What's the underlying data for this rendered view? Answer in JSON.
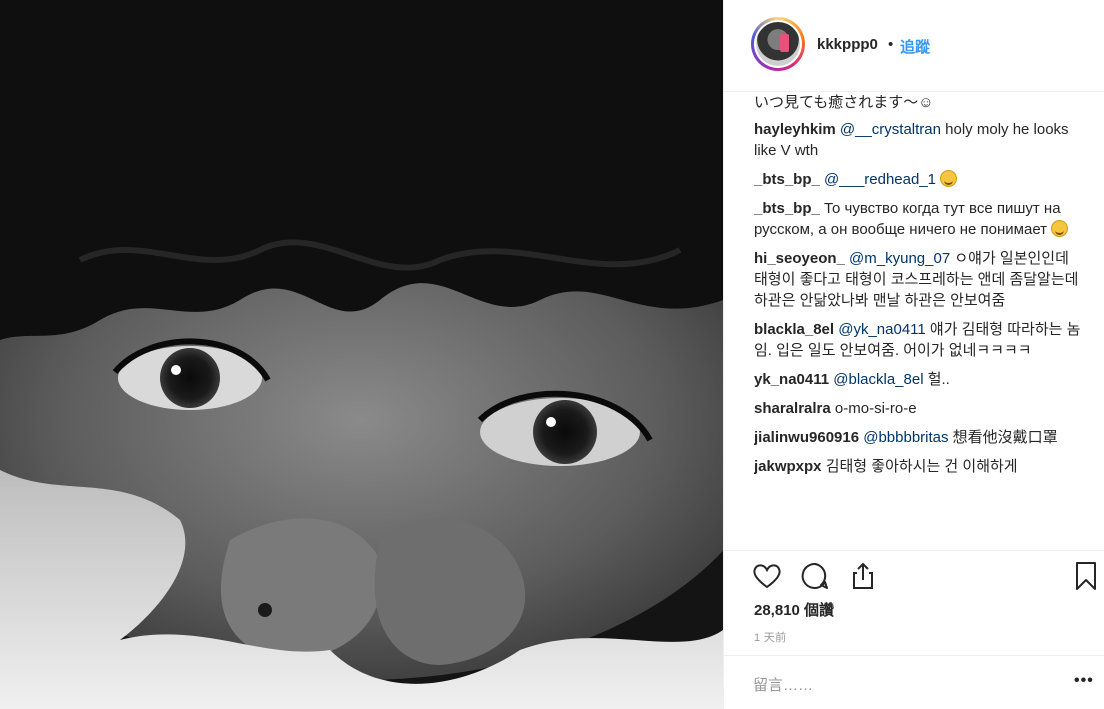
{
  "post": {
    "username": "kkkppp0",
    "separator": "•",
    "follow_label": "追蹤"
  },
  "comments": [
    {
      "text": "いつ見ても癒されます〜☺"
    },
    {
      "user": "hayleyhkim",
      "mention": "@__crystaltran",
      "text": " holy moly he looks like V wth"
    },
    {
      "user": "_bts_bp_",
      "mention": "@___redhead_1",
      "text": " ",
      "emoji": "grinning-sweat-emoji"
    },
    {
      "user": "_bts_bp_",
      "text": " То чувство когда тут все пишут на русском, а он вообще ничего не понимает ",
      "emoji": "grinning-sweat-emoji"
    },
    {
      "user": "hi_seoyeon_",
      "mention": "@m_kyung_07",
      "text": " ㅇ얘가 일본인인데 태형이 좋다고 태형이 코스프레하는 앤데 좀달알는데 하관은 안닮았나봐 맨날 하관은 안보여줌"
    },
    {
      "user": "blackla_8el",
      "mention": "@yk_na0411",
      "text": " 얘가 김태형 따라하는 놈임. 입은 일도 안보여줌. 어이가 없네ㅋㅋㅋㅋ"
    },
    {
      "user": "yk_na0411",
      "mention": "@blackla_8el",
      "text": " 헐.."
    },
    {
      "user": "sharalralra",
      "text": " o-mo-si-ro-e"
    },
    {
      "user": "jialinwu960916",
      "mention": "@bbbbbritas",
      "text": " 想看他沒戴口罩"
    },
    {
      "user": "jakwpxpx",
      "text": " 김태형 좋아하시는 건 이해하게"
    }
  ],
  "actions": {
    "like_icon": "heart-icon",
    "comment_icon": "speech-bubble-icon",
    "share_icon": "share-icon",
    "save_icon": "bookmark-icon"
  },
  "likes_label": "28,810 個讚",
  "timestamp": "1 天前",
  "comment_box": {
    "placeholder": "留言……",
    "more_label": "•••"
  },
  "colors": {
    "link": "#3897f0",
    "mention": "#003569",
    "text": "#262626",
    "muted": "#999999"
  }
}
